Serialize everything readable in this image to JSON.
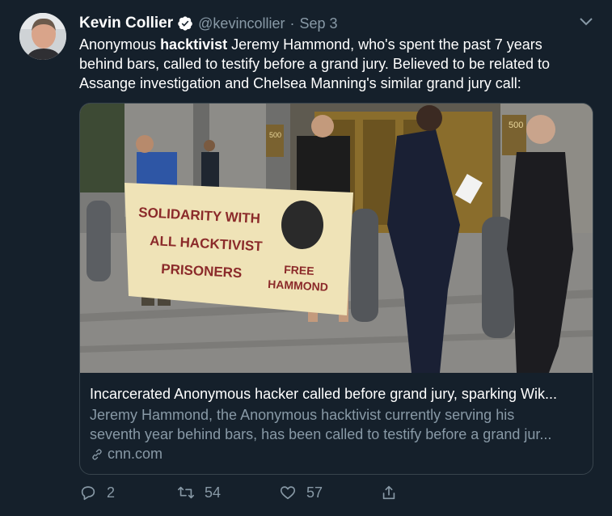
{
  "tweet": {
    "author_name": "Kevin Collier",
    "handle": "@kevincollier",
    "separator": "·",
    "date": "Sep 3",
    "text_before_bold": "Anonymous ",
    "text_bold": "hacktivist",
    "text_after_bold": " Jeremy Hammond, who's spent the past 7 years behind bars, called to testify before a grand jury. Believed to be related to Assange investigation and Chelsea Manning's similar grand jury call:"
  },
  "card": {
    "image_banner_lines": [
      "SOLIDARITY WITH",
      "ALL HACKTIVIST",
      "PRISONERS"
    ],
    "image_banner_free": [
      "FREE",
      "HAMMOND"
    ],
    "image_building_number_1": "500",
    "image_building_number_2": "500",
    "title": "Incarcerated Anonymous hacker called before grand jury, sparking Wik...",
    "description_line1": "Jeremy Hammond, the Anonymous hacktivist currently serving his",
    "description_line2": "seventh year behind bars, has been called to testify before a grand jur...",
    "domain": "cnn.com"
  },
  "actions": {
    "reply_count": "2",
    "retweet_count": "54",
    "like_count": "57"
  },
  "colors": {
    "background": "#15202b",
    "secondary_text": "#8899a6",
    "border": "#38444d",
    "verified": "#ffffff"
  },
  "icons": [
    "verified-icon",
    "chevron-down-icon",
    "link-icon",
    "reply-icon",
    "retweet-icon",
    "like-icon",
    "share-icon"
  ]
}
